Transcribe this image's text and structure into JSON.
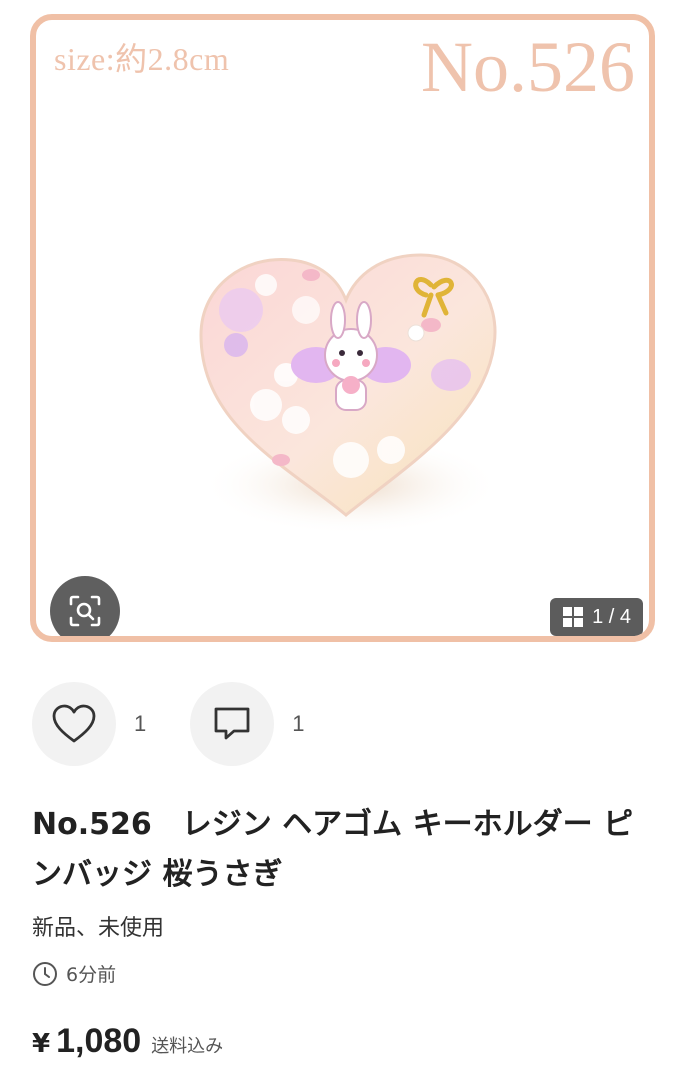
{
  "photo": {
    "size_text": "size:約2.8cm",
    "number_text": "No.526",
    "counter": "1 / 4",
    "icons": {
      "zoom": "scan-search-icon",
      "counter": "grid-icon"
    },
    "accent_color": "#f0c0a6"
  },
  "actions": {
    "like_icon": "heart-icon",
    "like_count": "1",
    "comment_icon": "comment-icon",
    "comment_count": "1"
  },
  "item": {
    "title": "No.526　レジン ヘアゴム キーホルダー ピンバッジ 桜うさぎ",
    "condition": "新品、未使用",
    "time_icon": "clock-icon",
    "posted": "6分前",
    "currency": "¥",
    "price": "1,080",
    "shipping": "送料込み"
  }
}
